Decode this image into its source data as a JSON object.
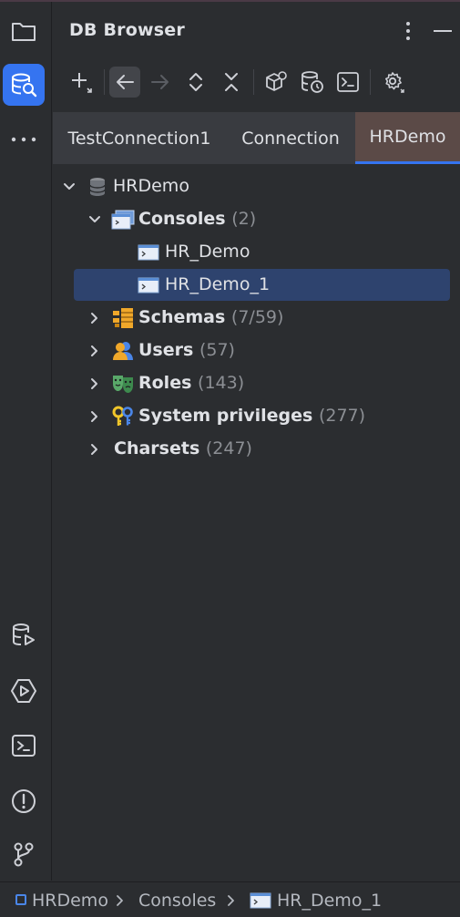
{
  "header": {
    "title": "DB Browser",
    "more_icon": "more-vertical-icon",
    "minimize_icon": "minimize-icon"
  },
  "stripe": {
    "top": [
      {
        "icon": "folder-icon",
        "active": false
      },
      {
        "icon": "db-browser-icon",
        "active": true
      },
      {
        "icon": "more-horizontal-icon",
        "active": false
      }
    ],
    "bottom": [
      {
        "icon": "db-execution-icon"
      },
      {
        "icon": "services-icon"
      },
      {
        "icon": "terminal-icon"
      },
      {
        "icon": "problems-icon"
      },
      {
        "icon": "git-icon"
      }
    ]
  },
  "toolbar": {
    "icons": [
      "add-connection-icon",
      "back-icon",
      "forward-icon",
      "expand-all-icon",
      "collapse-all-icon",
      "object-properties-icon",
      "db-session-icon",
      "console-icon",
      "settings-icon"
    ]
  },
  "tabs": [
    {
      "label": "TestConnection1",
      "active": false
    },
    {
      "label": "Connection",
      "active": false
    },
    {
      "label": "HRDemo",
      "active": true
    }
  ],
  "tree": {
    "root": {
      "label": "HRDemo",
      "icon": "database-icon",
      "expanded": true
    },
    "consoles": {
      "label": "Consoles",
      "count": "(2)",
      "icon": "consoles-icon",
      "expanded": true
    },
    "console_items": [
      {
        "label": "HR_Demo",
        "icon": "console-item-icon",
        "selected": false
      },
      {
        "label": "HR_Demo_1",
        "icon": "console-item-icon",
        "selected": true
      }
    ],
    "groups": [
      {
        "label": "Schemas",
        "count": "(7/59)",
        "icon": "schemas-icon"
      },
      {
        "label": "Users",
        "count": "(57)",
        "icon": "users-icon"
      },
      {
        "label": "Roles",
        "count": "(143)",
        "icon": "roles-icon"
      },
      {
        "label": "System privileges",
        "count": "(277)",
        "icon": "privileges-icon"
      },
      {
        "label": "Charsets",
        "count": "(247)",
        "icon": ""
      }
    ]
  },
  "statusbar": {
    "crumbs": [
      "HRDemo",
      "Consoles",
      "HR_Demo_1"
    ]
  },
  "colors": {
    "accent": "#3574f0",
    "selection": "#2e436e",
    "active_tab": "#5b4a47",
    "count_text": "#8c8f94"
  }
}
